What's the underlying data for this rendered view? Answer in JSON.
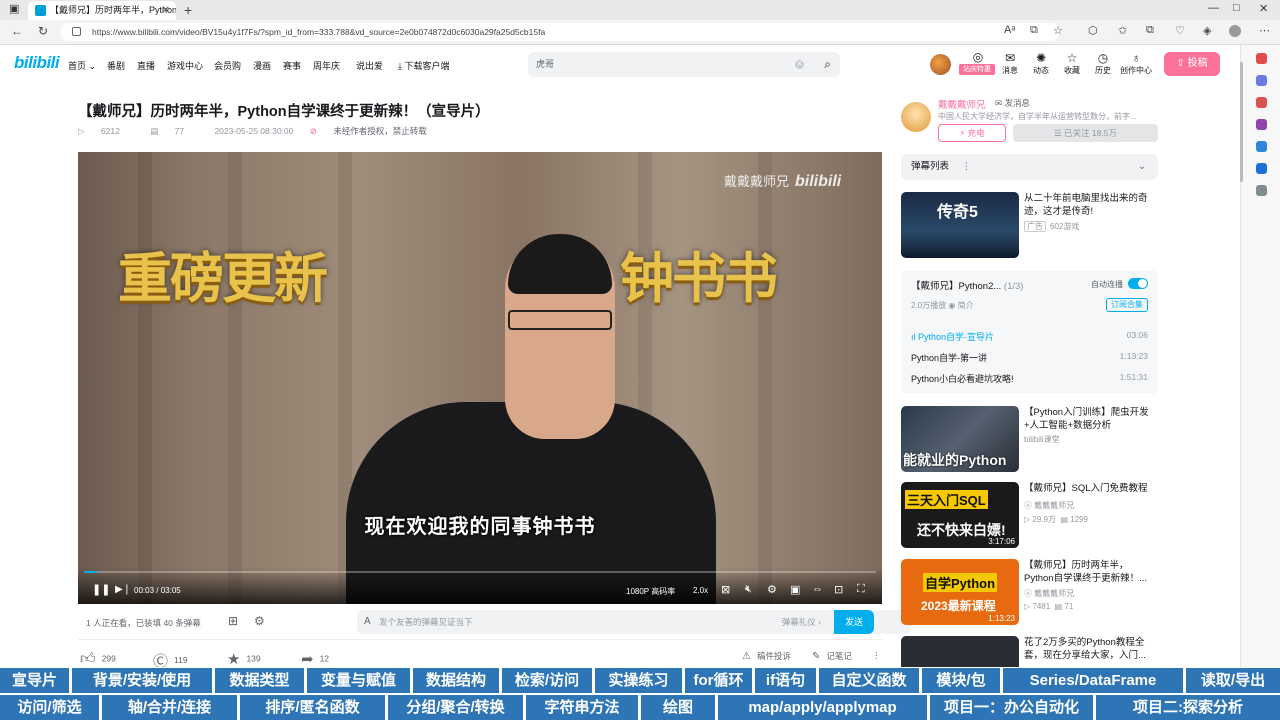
{
  "browser": {
    "tab_title": "【戴师兄】历时两年半，Python自",
    "url": "https://www.bilibili.com/video/BV15u4y1f7Fs/?spm_id_from=333.788&vd_source=2e0b074872d0c6030a29fa25d5cb15fa"
  },
  "header": {
    "logo": "bilibili",
    "nav": [
      "首页",
      "番剧",
      "直播",
      "游戏中心",
      "会员购",
      "漫画",
      "赛事",
      "周年庆",
      "说出爱",
      "下载客户端"
    ],
    "search_placeholder": "虎哥",
    "vip_badge": "站庆特惠",
    "icons": [
      "消息",
      "动态",
      "收藏",
      "历史",
      "创作中心"
    ],
    "upload": "投稿"
  },
  "video": {
    "title": "【戴师兄】历时两年半，Python自学课终于更新辣！（宣导片）",
    "plays": "6212",
    "danmaku": "77",
    "date": "2023-05-25 08:30:00",
    "copyright": "未经作者授权，禁止转载"
  },
  "player": {
    "caption_left": "重磅更新",
    "caption_right": "钟书书",
    "watermark_name": "戴戴戴师兄",
    "watermark_logo": "bilibili",
    "subtitle": "现在欢迎我的同事钟书书",
    "time_current": "00:03",
    "time_sep": "/",
    "time_total": "03:05",
    "quality": "1080P 高码率",
    "speed": "2.0x",
    "progress": 0.016
  },
  "danmaku_bar": {
    "watching": "1 人正在看，已装填 40 条弹幕",
    "placeholder": "发个友善的弹幕见证当下",
    "etiquette": "弹幕礼仪 ›",
    "send": "发送"
  },
  "actions": {
    "like": "299",
    "coin": "119",
    "fav": "139",
    "share": "12",
    "report": "稿件投诉",
    "note": "记笔记"
  },
  "uploader": {
    "name": "戴戴戴师兄",
    "message": "发消息",
    "desc": "中国人民大学经济学，自学半年从运营转型数分，前字...",
    "charge": "充电",
    "follow": "已关注 18.5万"
  },
  "sidebar": {
    "danmaku_list": "弹幕列表",
    "ad": {
      "title": "从二十年前电脑里找出来的奇迹，这才是传奇!",
      "tag": "广告",
      "source": "602游戏",
      "thumb_text": "传奇5"
    },
    "collection": {
      "title": "【戴师兄】Python2...",
      "count": "(1/3)",
      "autoplay": "自动连播",
      "plays": "2.0万播放",
      "intro": "简介",
      "subscribe": "订阅合集",
      "items": [
        {
          "title": "Python自学-宣导片",
          "dur": "03:06"
        },
        {
          "title": "Python自学-第一讲",
          "dur": "1:13:23"
        },
        {
          "title": "Python小白必看避坑攻略!",
          "dur": "1:51:31"
        }
      ]
    },
    "recs": [
      {
        "title": "【Python入门训练】爬虫开发+人工智能+数据分析",
        "author": "bilibili课堂",
        "thumb_text": "能就业的Python"
      },
      {
        "title": "【戴师兄】SQL入门免费教程",
        "author": "戴戴戴师兄",
        "views": "29.9万",
        "danmaku": "1299",
        "thumb_text1": "三天入门SQL",
        "thumb_text2": "还不快来白嫖!",
        "dur": "3:17:06"
      },
      {
        "title": "【戴师兄】历时两年半，Python自学课终于更新辣！...",
        "author": "戴戴戴师兄",
        "views": "7481",
        "danmaku": "71",
        "thumb_text1": "自学Python",
        "thumb_text2": "2023最新课程",
        "dur": "1:13:23"
      },
      {
        "title": "花了2万多买的Python教程全套，现在分享给大家，入门..."
      }
    ]
  },
  "chapters": {
    "row1": [
      "宣导片",
      "背景/安装/使用",
      "数据类型",
      "变量与赋值",
      "数据结构",
      "检索/访问",
      "实操练习",
      "for循环",
      "if语句",
      "自定义函数",
      "模块/包",
      "Series/DataFrame",
      "读取/导出"
    ],
    "row2": [
      "访问/筛选",
      "轴/合并/连接",
      "排序/匿名函数",
      "分组/聚合/转换",
      "字符串方法",
      "绘图",
      "map/apply/applymap",
      "项目一：办公自动化",
      "项目二:探索分析"
    ]
  },
  "colors": {
    "accent": "#00aeec",
    "pink": "#fb7299",
    "chapter_blue": "#2e75b6"
  }
}
